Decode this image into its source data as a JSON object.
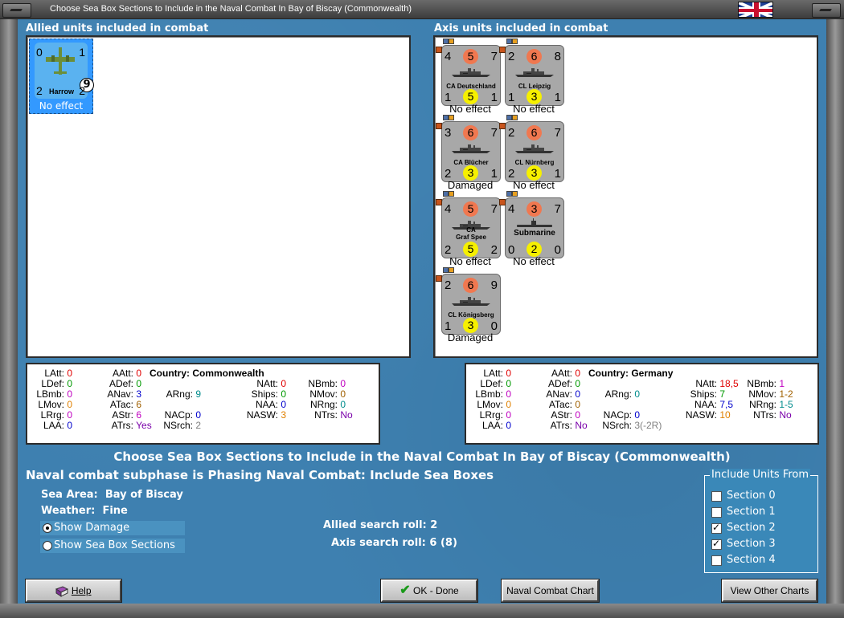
{
  "window": {
    "title": "Choose Sea Box Sections to Include in the Naval Combat In Bay of Biscay (Commonwealth)"
  },
  "allied": {
    "header": "Allied units included in combat",
    "units": [
      {
        "tl": "0",
        "tr": "1",
        "bl": "2",
        "br": "2",
        "badge": "9",
        "name": "Harrow",
        "status": "No effect"
      }
    ]
  },
  "axis": {
    "header": "Axis units included in combat",
    "units": [
      {
        "tl": "4",
        "att": "5",
        "tr": "7",
        "bl": "1",
        "def": "5",
        "br": "1",
        "name": "CA Deutschland",
        "status": "No effect"
      },
      {
        "tl": "2",
        "att": "6",
        "tr": "8",
        "bl": "1",
        "def": "3",
        "br": "1",
        "name": "CL Leipzig",
        "status": "No effect"
      },
      {
        "tl": "3",
        "att": "6",
        "tr": "7",
        "bl": "2",
        "def": "3",
        "br": "1",
        "name": "CA Blücher",
        "status": "Damaged"
      },
      {
        "tl": "2",
        "att": "6",
        "tr": "7",
        "bl": "2",
        "def": "3",
        "br": "1",
        "name": "CL Nürnberg",
        "status": "No effect"
      },
      {
        "tl": "4",
        "att": "5",
        "tr": "7",
        "bl": "2",
        "def": "5",
        "br": "2",
        "name": "CA",
        "name2": "Graf Spee",
        "status": "No effect"
      },
      {
        "tl": "4",
        "att": "3",
        "tr": "7",
        "bl": "0",
        "def": "2",
        "br": "0",
        "name": "Submarine",
        "status": "No effect"
      },
      {
        "tl": "2",
        "att": "6",
        "tr": "9",
        "bl": "1",
        "def": "3",
        "br": "0",
        "name": "CL Königsberg",
        "status": "Damaged"
      }
    ]
  },
  "stats_allied": {
    "country_label": "Country:",
    "country": "Commonwealth",
    "LAtt": "0",
    "AAtt": "0",
    "LDef": "0",
    "ADef": "0",
    "LBmb": "0",
    "ANav": "3",
    "LMov": "0",
    "ATac": "6",
    "LRrg": "0",
    "AStr": "6",
    "LAA": "0",
    "ATrs": "Yes",
    "ARng": "9",
    "NACp": "0",
    "NSrch": "2",
    "NAtt": "0",
    "Ships": "0",
    "NAA": "0",
    "NASW": "3",
    "NBmb": "0",
    "NMov": "0",
    "NRng": "0",
    "NTrs": "No"
  },
  "stats_axis": {
    "country_label": "Country:",
    "country": "Germany",
    "LAtt": "0",
    "AAtt": "0",
    "LDef": "0",
    "ADef": "0",
    "LBmb": "0",
    "ANav": "0",
    "LMov": "0",
    "ATac": "0",
    "LRrg": "0",
    "AStr": "0",
    "LAA": "0",
    "ATrs": "No",
    "ARng": "0",
    "NACp": "0",
    "NSrch": "3(-2R)",
    "NAtt": "18,5",
    "Ships": "7",
    "NAA": "7,5",
    "NASW": "10",
    "NBmb": "1",
    "NMov": "1-2",
    "NRng": "1-5",
    "NTrs": "No"
  },
  "labels": {
    "LAtt": "LAtt:",
    "AAtt": "AAtt:",
    "LDef": "LDef:",
    "ADef": "ADef:",
    "LBmb": "LBmb:",
    "ANav": "ANav:",
    "LMov": "LMov:",
    "ATac": "ATac:",
    "LRrg": "LRrg:",
    "AStr": "AStr:",
    "LAA": "LAA:",
    "ATrs": "ATrs:",
    "ARng": "ARng:",
    "NACp": "NACp:",
    "NSrch": "NSrch:",
    "NAtt": "NAtt:",
    "Ships": "Ships:",
    "NAA": "NAA:",
    "NASW": "NASW:",
    "NBmb": "NBmb:",
    "NMov": "NMov:",
    "NRng": "NRng:",
    "NTrs": "NTrs:"
  },
  "info": {
    "heading": "Choose Sea Box Sections to Include in the Naval Combat In Bay of Biscay (Commonwealth)",
    "subphase": "Naval combat subphase is Phasing Naval Combat: Include Sea Boxes",
    "sea_area_label": "Sea Area:",
    "sea_area": "Bay of Biscay",
    "weather_label": "Weather:",
    "weather": "Fine",
    "allied_roll_label": "Allied search roll:",
    "allied_roll": "2",
    "axis_roll_label": "Axis search roll:",
    "axis_roll": "6 (8)"
  },
  "options": {
    "show_damage": "Show Damage",
    "show_sections": "Show Sea Box Sections"
  },
  "include": {
    "legend": "Include Units From",
    "sections": [
      {
        "label": "Section 0",
        "checked": false
      },
      {
        "label": "Section 1",
        "checked": false
      },
      {
        "label": "Section 2",
        "checked": true
      },
      {
        "label": "Section 3",
        "checked": true
      },
      {
        "label": "Section 4",
        "checked": false
      }
    ]
  },
  "buttons": {
    "help": "Help",
    "ok": "OK - Done",
    "naval_chart": "Naval Combat Chart",
    "other_charts": "View Other Charts"
  }
}
